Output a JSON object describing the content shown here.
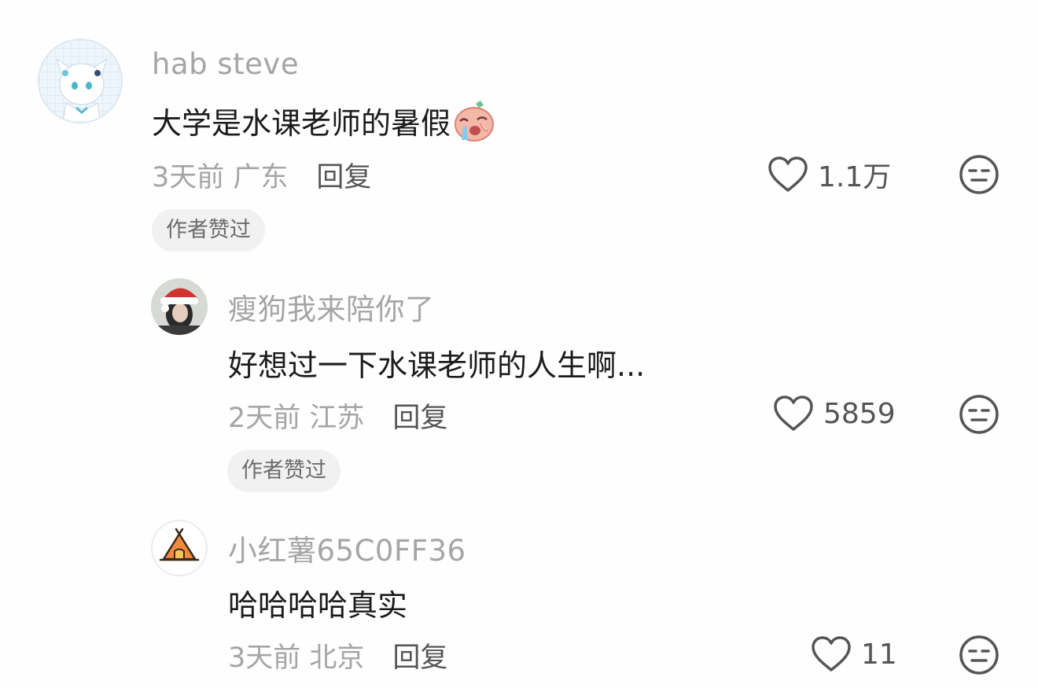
{
  "comments": [
    {
      "username": "hab steve",
      "text": "大学是水课老师的暑假",
      "emoji": "crying-face-emoji",
      "time_location": "3天前 广东",
      "reply_label": "回复",
      "likes": "1.1万",
      "badge": "作者赞过"
    },
    {
      "username": "瘦狗我来陪你了",
      "text": "好想过一下水课老师的人生啊...",
      "time_location": "2天前 江苏",
      "reply_label": "回复",
      "likes": "5859",
      "badge": "作者赞过"
    },
    {
      "username": "小红薯65C0FF36",
      "text": "哈哈哈哈真实",
      "time_location": "3天前 北京",
      "reply_label": "回复",
      "likes": "11"
    }
  ],
  "icons": {
    "like": "heart-outline-icon",
    "dislike": "neutral-face-icon",
    "avatar1": "anime-cat-girl-avatar",
    "avatar2": "christmas-hat-avatar",
    "avatar3": "tent-avatar"
  },
  "colors": {
    "username": "#a5a5a5",
    "text": "#1c1c1c",
    "action": "#555555",
    "badge_bg": "#f1f1f1"
  }
}
